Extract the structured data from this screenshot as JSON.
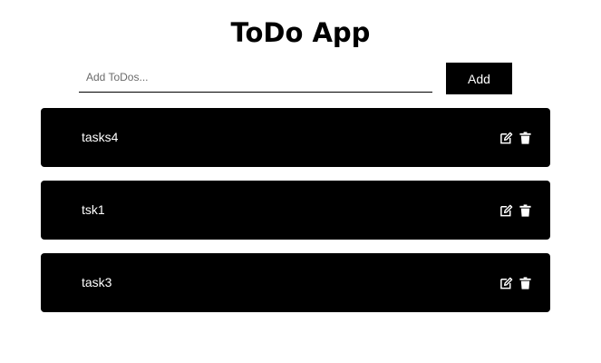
{
  "header": {
    "title": "ToDo App"
  },
  "form": {
    "placeholder": "Add ToDos...",
    "value": "",
    "add_label": "Add"
  },
  "todos": [
    {
      "text": "tasks4",
      "edit_icon": "edit-icon",
      "delete_icon": "trash-icon"
    },
    {
      "text": "tsk1",
      "edit_icon": "edit-icon",
      "delete_icon": "trash-icon"
    },
    {
      "text": "task3",
      "edit_icon": "edit-icon",
      "delete_icon": "trash-icon"
    }
  ],
  "colors": {
    "background": "#ffffff",
    "item_background": "#000000",
    "item_text": "#ffffff",
    "button_background": "#000000"
  }
}
